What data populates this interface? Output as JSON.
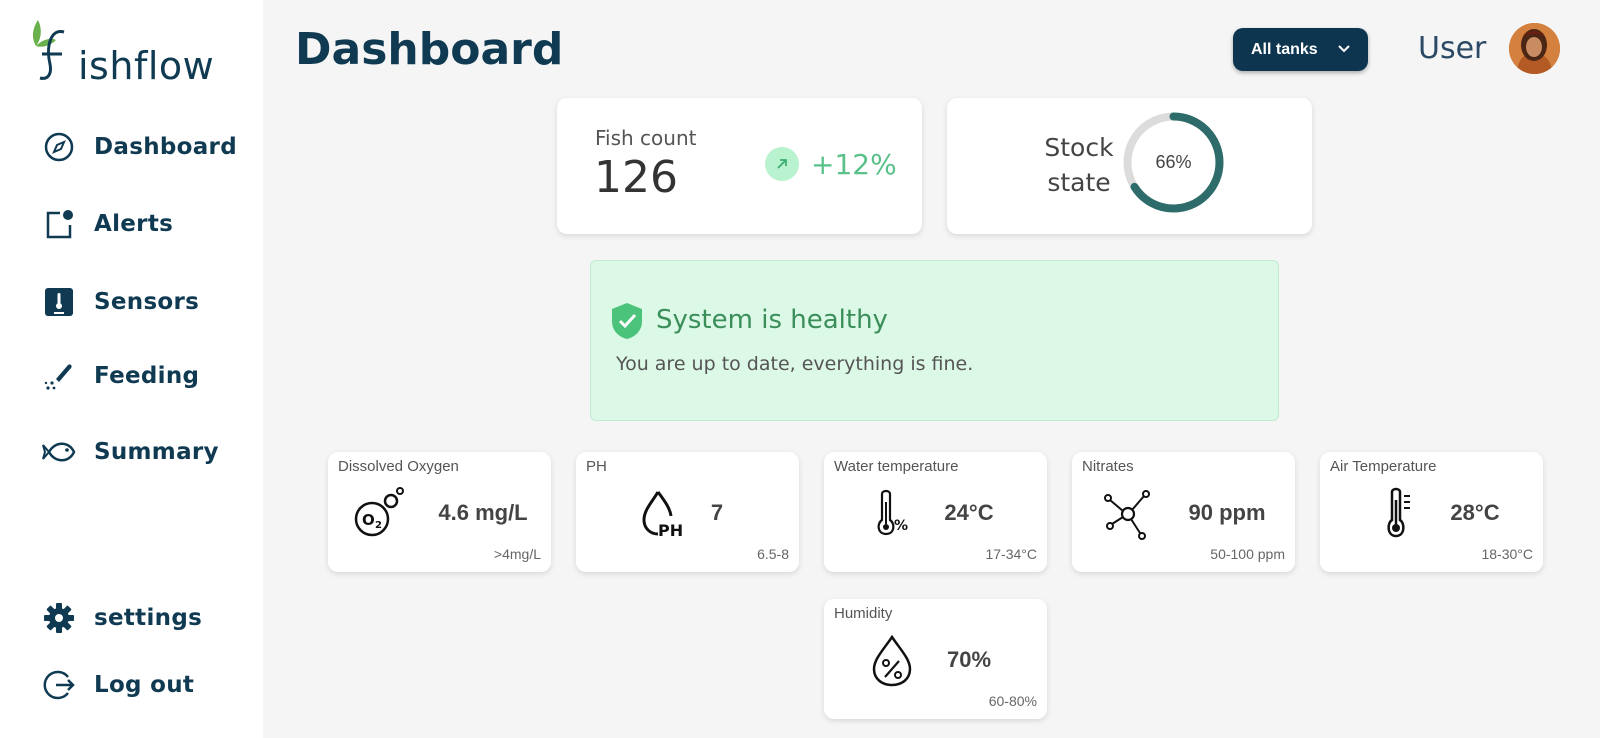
{
  "brand": {
    "name": "Fishflow",
    "logo_text": "ishflow"
  },
  "sidebar": {
    "items": [
      {
        "label": "Dashboard",
        "icon": "compass-icon"
      },
      {
        "label": "Alerts",
        "icon": "alert-notification-icon"
      },
      {
        "label": "Sensors",
        "icon": "sensor-icon"
      },
      {
        "label": "Feeding",
        "icon": "feeding-icon"
      },
      {
        "label": "Summary",
        "icon": "fish-icon"
      }
    ],
    "bottom": [
      {
        "label": "settings",
        "icon": "gear-icon"
      },
      {
        "label": "Log out",
        "icon": "logout-icon"
      }
    ]
  },
  "header": {
    "title": "Dashboard",
    "tank_select": "All tanks",
    "user": "User"
  },
  "fish_count": {
    "label": "Fish count",
    "value": "126",
    "trend": "+12%"
  },
  "stock_state": {
    "label_line1": "Stock",
    "label_line2": "state",
    "percent": "66%",
    "fraction": 0.66
  },
  "health": {
    "title": "System is healthy",
    "message": "You are up to date, everything is fine."
  },
  "sensors": [
    {
      "title": "Dissolved Oxygen",
      "value": "4.6 mg/L",
      "range": ">4mg/L",
      "icon": "oxygen-icon"
    },
    {
      "title": "PH",
      "value": "7",
      "range": "6.5-8",
      "icon": "ph-drop-icon"
    },
    {
      "title": "Water temperature",
      "value": "24°C",
      "range": "17-34°C",
      "icon": "water-temperature-icon"
    },
    {
      "title": "Nitrates",
      "value": "90 ppm",
      "range": "50-100 ppm",
      "icon": "molecule-icon"
    },
    {
      "title": "Air Temperature",
      "value": "28°C",
      "range": "18-30°C",
      "icon": "thermometer-icon"
    },
    {
      "title": "Humidity",
      "value": "70%",
      "range": "60-80%",
      "icon": "humidity-drop-icon"
    }
  ],
  "colors": {
    "primary": "#0f3a52",
    "accent_green": "#5ac18b",
    "healthy_bg": "#dcf8e6",
    "ring": "#2e6b6b"
  }
}
